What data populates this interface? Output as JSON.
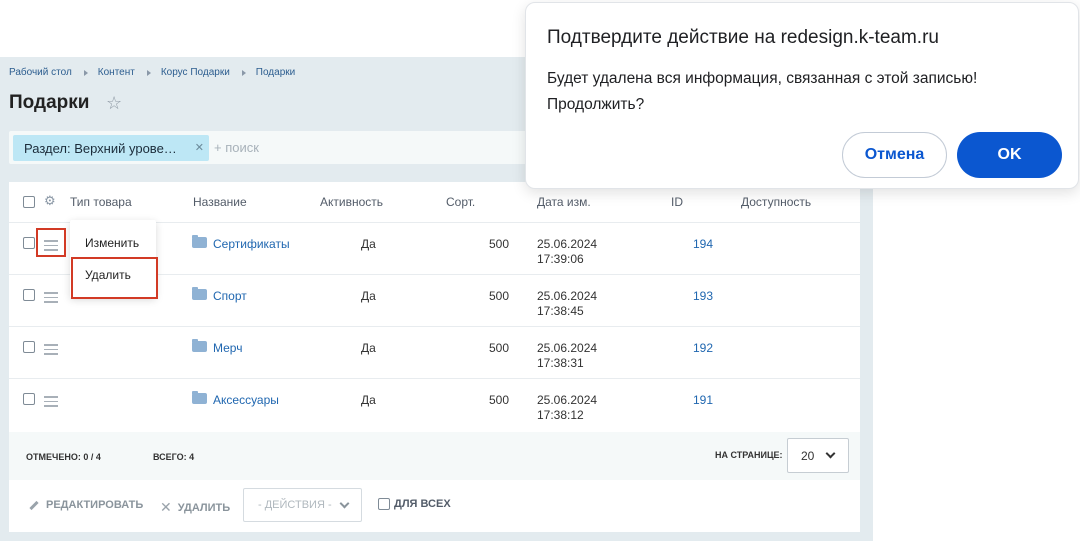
{
  "breadcrumb": [
    "Рабочий стол",
    "Контент",
    "Корус Подарки",
    "Подарки"
  ],
  "page_title": "Подарки",
  "filter": {
    "chip_label": "Раздел: Верхний урове…",
    "search_placeholder": "+ поиск"
  },
  "columns": [
    "Тип товара",
    "Название",
    "Активность",
    "Сорт.",
    "Дата изм.",
    "ID",
    "Доступность"
  ],
  "rows": [
    {
      "name": "Сертификаты",
      "active": "Да",
      "sort": "500",
      "date": "25.06.2024",
      "time": "17:39:06",
      "id": "194"
    },
    {
      "name": "Спорт",
      "active": "Да",
      "sort": "500",
      "date": "25.06.2024",
      "time": "17:38:45",
      "id": "193"
    },
    {
      "name": "Мерч",
      "active": "Да",
      "sort": "500",
      "date": "25.06.2024",
      "time": "17:38:31",
      "id": "192"
    },
    {
      "name": "Аксессуары",
      "active": "Да",
      "sort": "500",
      "date": "25.06.2024",
      "time": "17:38:12",
      "id": "191"
    }
  ],
  "context_menu": {
    "edit": "Изменить",
    "delete": "Удалить"
  },
  "footer": {
    "selected": "ОТМЕЧЕНО: 0 / 4",
    "total": "ВСЕГО: 4",
    "per_page_label": "НА СТРАНИЦЕ:",
    "per_page_value": "20"
  },
  "actions": {
    "edit": "РЕДАКТИРОВАТЬ",
    "delete": "УДАЛИТЬ",
    "select": "- ДЕЙСТВИЯ -",
    "for_all": "ДЛЯ ВСЕХ"
  },
  "dialog": {
    "title": "Подтвердите действие на redesign.k-team.ru",
    "message": "Будет удалена вся информация, связанная с этой записью!\nПродолжить?",
    "cancel": "Отмена",
    "ok": "OK"
  },
  "colors": {
    "accent": "#0b57d0",
    "highlight": "#d23a25",
    "chip": "#bde7f5",
    "link": "#2067b0"
  }
}
